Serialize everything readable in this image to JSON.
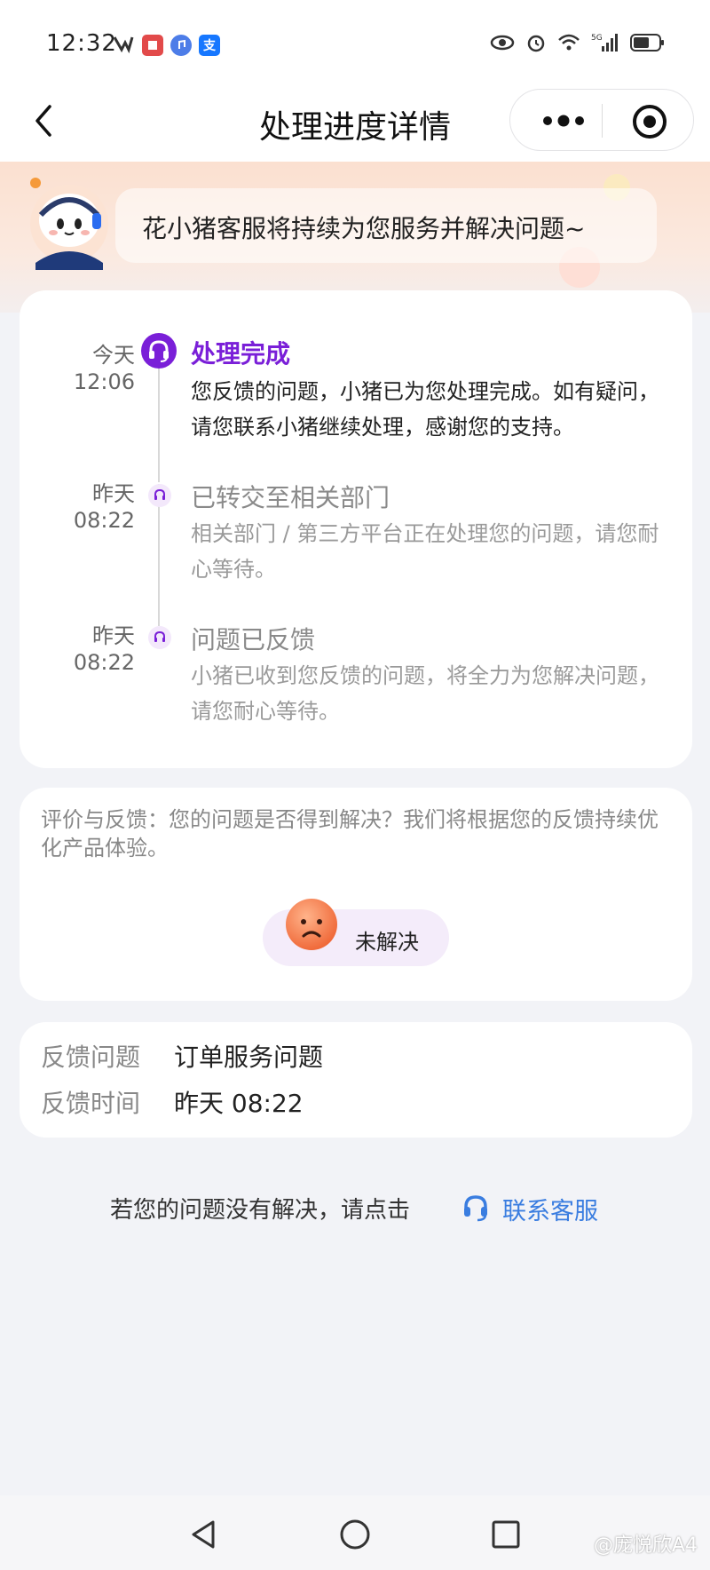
{
  "status_bar": {
    "time": "12:32",
    "app_icons": [
      "app-a",
      "note",
      "music",
      "支"
    ],
    "network": "5G",
    "battery_level": 0.55
  },
  "nav": {
    "title": "处理进度详情",
    "back_icon": "chevron-left-icon",
    "more_icon": "more-dots-icon",
    "close_icon": "target-icon"
  },
  "banner": {
    "message": "花小猪客服将持续为您服务并解决问题~"
  },
  "timeline": [
    {
      "day": "今天",
      "time": "12:06",
      "title": "处理完成",
      "body": "您反馈的问题，小猪已为您处理完成。如有疑问，请您联系小猪继续处理，感谢您的支持。",
      "state": "active"
    },
    {
      "day": "昨天",
      "time": "08:22",
      "title": "已转交至相关部门",
      "body": "相关部门 / 第三方平台正在处理您的问题，请您耐心等待。",
      "state": "inactive"
    },
    {
      "day": "昨天",
      "time": "08:22",
      "title": "问题已反馈",
      "body": "小猪已收到您反馈的问题，将全力为您解决问题，请您耐心等待。",
      "state": "inactive"
    }
  ],
  "feedback": {
    "prompt": "评价与反馈：您的问题是否得到解决？我们将根据您的反馈持续优化产品体验。",
    "unsolved_label": "未解决"
  },
  "info": {
    "rows": [
      {
        "key": "反馈问题",
        "value": "订单服务问题"
      },
      {
        "key": "反馈时间",
        "value": "昨天 08:22"
      }
    ]
  },
  "contact": {
    "hint": "若您的问题没有解决，请点击",
    "link": "联系客服"
  },
  "colors": {
    "accent_purple": "#7a1fd8",
    "link_blue": "#3a7de0",
    "background": "#f2f3f7"
  },
  "watermark": "@庞悦欣A4"
}
